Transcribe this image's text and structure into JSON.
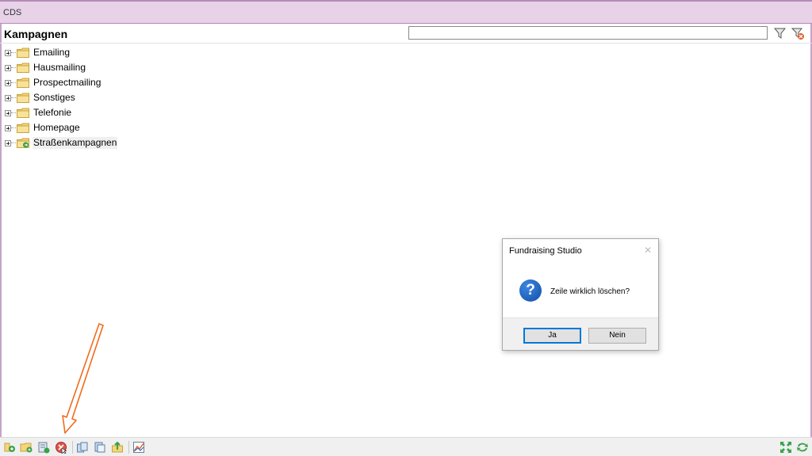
{
  "window": {
    "title": "CDS"
  },
  "header": {
    "title": "Kampagnen",
    "search_value": ""
  },
  "tree": {
    "items": [
      {
        "label": "Emailing",
        "icon": "folder-icon"
      },
      {
        "label": "Hausmailing",
        "icon": "folder-icon"
      },
      {
        "label": "Prospectmailing",
        "icon": "folder-icon"
      },
      {
        "label": "Sonstiges",
        "icon": "folder-icon"
      },
      {
        "label": "Telefonie",
        "icon": "folder-icon"
      },
      {
        "label": "Homepage",
        "icon": "folder-icon"
      },
      {
        "label": "Straßenkampagnen",
        "icon": "folder-special-icon"
      }
    ]
  },
  "dialog": {
    "title": "Fundraising Studio",
    "close": "✕",
    "icon": "question-icon",
    "icon_glyph": "?",
    "message": "Zeile wirklich löschen?",
    "yes_label": "Ja",
    "no_label": "Nein"
  },
  "annotation": {
    "color": "#f26b1d"
  },
  "colors": {
    "titlebar": "#e7d2e8",
    "folder": "#f5d57a",
    "accent": "#0078d7"
  }
}
